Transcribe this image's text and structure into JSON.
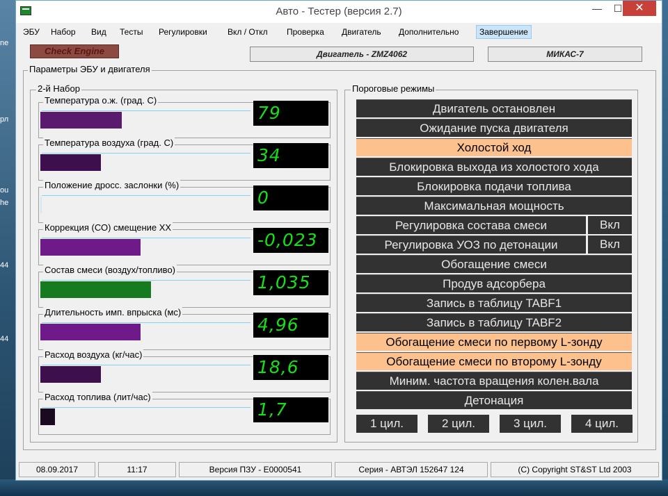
{
  "desktop": {
    "frag1": "ne",
    "frag2": "рл",
    "frag3": "ou",
    "frag4": "he",
    "frag5": "44",
    "frag6": "44"
  },
  "window": {
    "title": "Авто - Тестер  (версия 2.7)",
    "close_glyph": "✕",
    "min_glyph": "—",
    "max_glyph": "☐"
  },
  "menu": [
    "ЭБУ",
    "Набор",
    "Вид",
    "Тесты",
    "Регулировки",
    "Вкл / Откл",
    "Проверка",
    "Двигатель",
    "Дополнительно",
    "Завершение"
  ],
  "check_engine": "Check Engine",
  "engine": "Двигатель - ZMZ4062",
  "ecu": "МИКАС-7",
  "ecu_group_label": "Параметры ЭБУ и двигателя",
  "set_label": "2-й  Набор",
  "params": [
    {
      "label": "Температура  о.ж. (град. С)",
      "value": "79",
      "fill": 0.39,
      "color": "#5a1a6e"
    },
    {
      "label": "Температура воздуха (град. С)",
      "value": "34",
      "fill": 0.29,
      "color": "#3e0f4d"
    },
    {
      "label": "Положение дросс. заслонки (%)",
      "value": "0",
      "fill": 0.0,
      "color": "#5a1a6e"
    },
    {
      "label": "Коррекция (СО) смещение  ХХ",
      "value": "-0,023",
      "fill": 0.48,
      "color": "#6e1a88"
    },
    {
      "label": "Состав смеси (воздух/топливо)",
      "value": "1,035",
      "fill": 0.53,
      "color": "#167a20"
    },
    {
      "label": "Длительность имп. впрыска (мс)",
      "value": "4,96",
      "fill": 0.48,
      "color": "#6e1a88"
    },
    {
      "label": "Расход воздуха (кг/час)",
      "value": "18,6",
      "fill": 0.29,
      "color": "#3e0f4d"
    },
    {
      "label": "Расход топлива (лит/час)",
      "value": "1,7",
      "fill": 0.07,
      "color": "#1a0a1f"
    }
  ],
  "modes_label": "Пороговые режимы",
  "modes": [
    {
      "label": "Двигатель остановлен",
      "active": false
    },
    {
      "label": "Ожидание пуска двигателя",
      "active": false
    },
    {
      "label": "Холостой ход",
      "active": true
    },
    {
      "label": "Блокировка выхода из холостого хода",
      "active": false
    },
    {
      "label": "Блокировка подачи топлива",
      "active": false
    },
    {
      "label": "Максимальная мощность",
      "active": false
    },
    {
      "label": "Регулировка состава смеси",
      "active": false,
      "btn": "Вкл"
    },
    {
      "label": "Регулировка УОЗ по детонации",
      "active": false,
      "btn": "Вкл"
    },
    {
      "label": "Обогащение смеси",
      "active": false
    },
    {
      "label": "Продув адсорбера",
      "active": false
    },
    {
      "label": "Запись в таблицу TABF1",
      "active": false
    },
    {
      "label": "Запись в таблицу TABF2",
      "active": false
    },
    {
      "label": "Обогащение смеси по первому L-зонду",
      "active": true
    },
    {
      "label": "Обогащение смеси по второму L-зонду",
      "active": true
    },
    {
      "label": "Миним. частота вращения колен.вала",
      "active": false
    },
    {
      "label": "Детонация",
      "active": false
    }
  ],
  "cylinders": [
    "1 цил.",
    "2 цил.",
    "3 цил.",
    "4 цил."
  ],
  "status": {
    "date": "08.09.2017",
    "time": "11:17",
    "rom": "Версия ПЗУ - E0000541",
    "serial": "Серия - АВТЭЛ 152647 124",
    "copyright": "(C) Copyright   ST&ST  Ltd 2003"
  }
}
